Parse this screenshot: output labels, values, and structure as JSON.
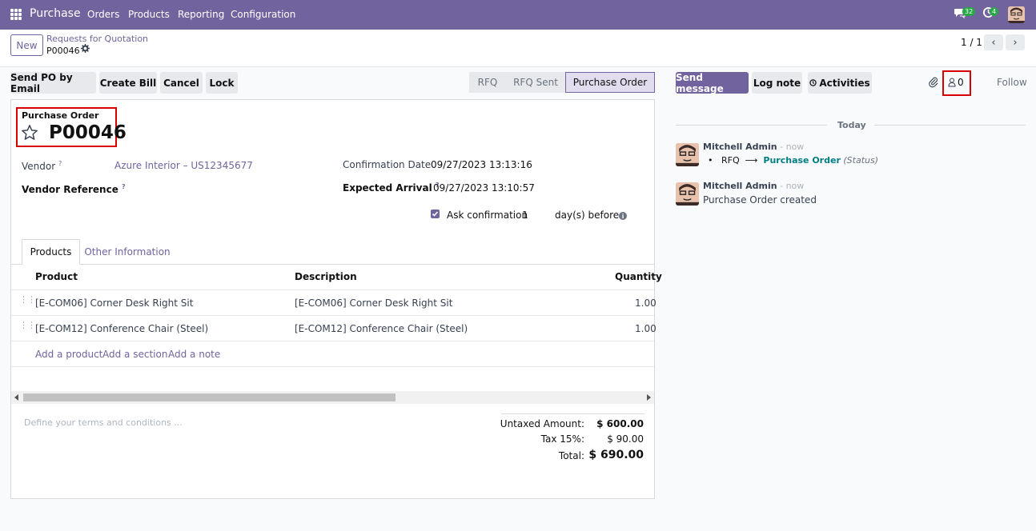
{
  "nav": {
    "brand": "Purchase",
    "menu": [
      "Orders",
      "Products",
      "Reporting",
      "Configuration"
    ],
    "chat_count": "32",
    "activity_count": "4",
    "brand_color": "#71639e"
  },
  "control_panel": {
    "new_label": "New",
    "breadcrumb_parent": "Requests for Quotation",
    "breadcrumb_current": "P00046",
    "pager": "1 / 1"
  },
  "actions": {
    "send_po": "Send PO by Email",
    "create_bill": "Create Bill",
    "cancel": "Cancel",
    "lock": "Lock"
  },
  "status": {
    "steps": [
      "RFQ",
      "RFQ Sent",
      "Purchase Order"
    ],
    "active": "Purchase Order"
  },
  "form": {
    "doc_type": "Purchase Order",
    "doc_name": "P00046",
    "vendor_label": "Vendor",
    "vendor_value": "Azure Interior – US12345677",
    "vendor_ref_label": "Vendor Reference",
    "confirmation_label": "Confirmation Date",
    "confirmation_value": "09/27/2023 13:13:16",
    "expected_label": "Expected Arrival",
    "expected_value": "09/27/2023 13:10:57",
    "ask_confirmation_label": "Ask confirmation",
    "ask_confirmation_checked": true,
    "days_value": "1",
    "days_suffix": "day(s) before"
  },
  "tabs": [
    "Products",
    "Other Information"
  ],
  "table": {
    "headers": [
      "Product",
      "Description",
      "Quantity"
    ],
    "rows": [
      {
        "product": "[E-COM06] Corner Desk Right Sit",
        "description": "[E-COM06] Corner Desk Right Sit",
        "quantity": "1.00"
      },
      {
        "product": "[E-COM12] Conference Chair (Steel)",
        "description": "[E-COM12] Conference Chair (Steel)",
        "quantity": "1.00"
      }
    ],
    "add_product": "Add a product",
    "add_section": "Add a section",
    "add_note": "Add a note"
  },
  "footer": {
    "terms_placeholder": "Define your terms and conditions ...",
    "untaxed_label": "Untaxed Amount:",
    "untaxed_value": "$ 600.00",
    "tax_label": "Tax 15%:",
    "tax_value": "$ 90.00",
    "total_label": "Total:",
    "total_value": "$ 690.00"
  },
  "chatter": {
    "send_message": "Send message",
    "log_note": "Log note",
    "activities": "Activities",
    "followers_count": "0",
    "follow": "Follow",
    "today": "Today",
    "messages": [
      {
        "author": "Mitchell Admin",
        "time": "- now",
        "from": "RFQ",
        "to": "Purchase Order",
        "field": "(Status)"
      },
      {
        "author": "Mitchell Admin",
        "time": "- now",
        "body": "Purchase Order created"
      }
    ]
  }
}
